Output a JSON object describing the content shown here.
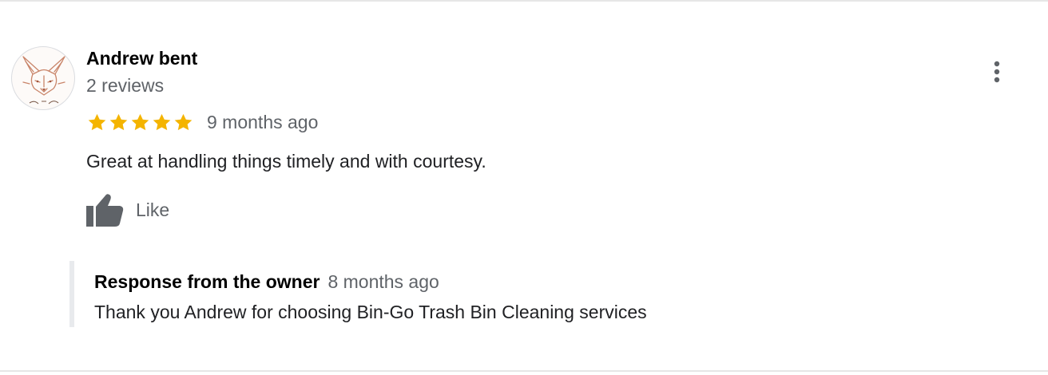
{
  "review": {
    "author": "Andrew bent",
    "review_count": "2 reviews",
    "rating": 5,
    "rating_max": 5,
    "time_ago": "9 months ago",
    "text": "Great at handling things timely and with courtesy.",
    "like_label": "Like",
    "avatar_icon": "fox-avatar-icon",
    "star_color": "#f4b400",
    "icon_color": "#5f6368"
  },
  "owner_response": {
    "title": "Response from the owner",
    "time_ago": "8 months ago",
    "text": "Thank you Andrew for choosing Bin-Go Trash Bin Cleaning services"
  }
}
